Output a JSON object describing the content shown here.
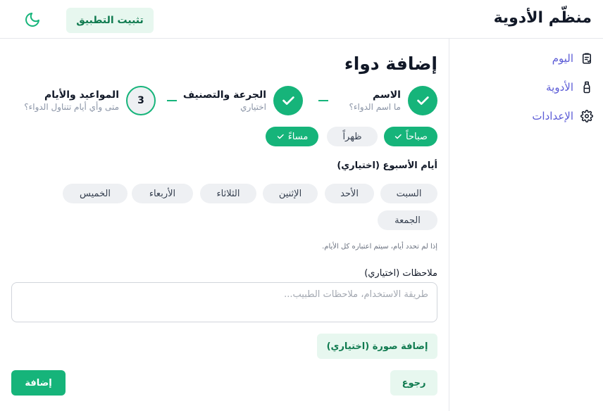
{
  "header": {
    "app_title": "منظّم الأدوية",
    "install_label": "تثبيت التطبيق",
    "theme_icon": "moon-icon"
  },
  "sidebar": {
    "items": [
      {
        "label": "اليوم",
        "icon": "clipboard-icon"
      },
      {
        "label": "الأدوية",
        "icon": "medicine-bottle-icon"
      },
      {
        "label": "الإعدادات",
        "icon": "gear-icon"
      }
    ]
  },
  "main": {
    "title": "إضافة دواء",
    "steps": [
      {
        "title": "الاسم",
        "subtitle": "ما اسم الدواء؟",
        "state": "done"
      },
      {
        "title": "الجرعة والتصنيف",
        "subtitle": "اختياري",
        "state": "done"
      },
      {
        "title": "المواعيد والأيام",
        "subtitle": "متى وأي أيام تتناول الدواء؟",
        "number": "3",
        "state": "current"
      }
    ],
    "times": [
      {
        "label": "صباحاً",
        "selected": true
      },
      {
        "label": "ظهراً",
        "selected": false
      },
      {
        "label": "مساءً",
        "selected": true
      }
    ],
    "weekdays_label": "أيام الأسبوع (اختياري)",
    "weekdays": [
      "السبت",
      "الأحد",
      "الإثنين",
      "الثلاثاء",
      "الأربعاء",
      "الخميس",
      "الجمعة"
    ],
    "weekdays_hint": "إذا لم تحدد أيام، سيتم اعتباره كل الأيام.",
    "notes_label": "ملاحظات (اختياري)",
    "notes_placeholder": "طريقة الاستخدام، ملاحظات الطبيب...",
    "notes_value": "",
    "photo_label": "إضافة صورة (اختياري)",
    "back_label": "رجوع",
    "submit_label": "إضافة"
  },
  "colors": {
    "accent": "#16b47a",
    "accent_light": "#e7f7ef",
    "accent_text": "#0f7a4f",
    "nav_text": "#5b5bd6"
  }
}
